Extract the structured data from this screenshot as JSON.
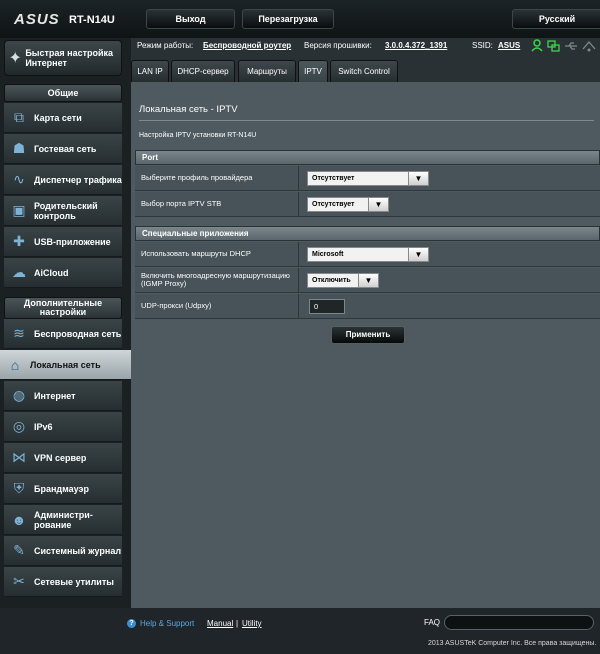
{
  "header": {
    "brand": "ASUS",
    "model": "RT-N14U",
    "logout": "Выход",
    "reboot": "Перезагрузка",
    "language": "Русский"
  },
  "status": {
    "mode_label": "Режим работы:",
    "mode_value": "Беспроводной роутер",
    "fw_label": "Версия прошивки:",
    "fw_value": "3.0.0.4.372_1391",
    "ssid_label": "SSID:",
    "ssid_value": "ASUS"
  },
  "sidebar": {
    "quick_setup": "Быстрая настройка Интернет",
    "general_header": "Общие",
    "general_items": [
      {
        "label": "Карта сети",
        "icon": "network-map-icon"
      },
      {
        "label": "Гостевая сеть",
        "icon": "guest-network-icon"
      },
      {
        "label": "Диспетчер трафика",
        "icon": "traffic-manager-icon"
      },
      {
        "label": "Родительский контроль",
        "icon": "lock-icon"
      },
      {
        "label": "USB-приложение",
        "icon": "puzzle-icon"
      },
      {
        "label": "AiCloud",
        "icon": "cloud-icon"
      }
    ],
    "advanced_header": "Дополнительные настройки",
    "advanced_items": [
      {
        "label": "Беспроводная сеть",
        "icon": "wifi-icon"
      },
      {
        "label": "Локальная сеть",
        "icon": "home-icon"
      },
      {
        "label": "Интернет",
        "icon": "globe-icon"
      },
      {
        "label": "IPv6",
        "icon": "ipv6-icon"
      },
      {
        "label": "VPN сервер",
        "icon": "vpn-icon"
      },
      {
        "label": "Брандмауэр",
        "icon": "shield-icon"
      },
      {
        "label": "Администри-рование",
        "icon": "admin-icon"
      },
      {
        "label": "Системный журнал",
        "icon": "log-icon"
      },
      {
        "label": "Сетевые утилиты",
        "icon": "tools-icon"
      }
    ]
  },
  "tabs": [
    "LAN IP",
    "DHCP-сервер",
    "Маршруты",
    "IPTV",
    "Switch Control"
  ],
  "page": {
    "title": "Локальная сеть - IPTV",
    "description": "Настройка IPTV установки RT-N14U"
  },
  "sections": [
    {
      "title": "Port",
      "rows": [
        {
          "label": "Выберите профиль провайдера",
          "value": "Отсутствует"
        },
        {
          "label": "Выбор порта IPTV STB",
          "value": "Отсутствует"
        }
      ]
    },
    {
      "title": "Специальные приложения",
      "rows": [
        {
          "label": "Использовать маршруты DHCP",
          "value": "Microsoft"
        },
        {
          "label": "Включить многоадресную маршрутизацию (IGMP Proxy)",
          "value": "Отключить"
        },
        {
          "label": "UDP-прокси (Udpxy)",
          "value": "0"
        }
      ]
    }
  ],
  "apply": "Применить",
  "footer": {
    "help": "Help & Support",
    "manual": "Manual",
    "sep": "|",
    "utility": "Utility",
    "faq": "FAQ",
    "copyright": "2013 ASUSTeK Computer Inc. Все права защищены."
  }
}
